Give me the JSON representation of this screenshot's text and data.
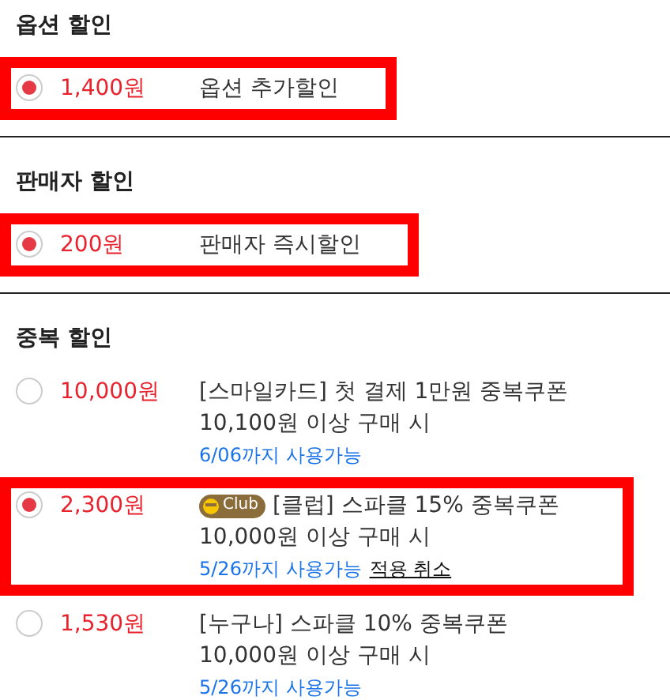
{
  "sections": [
    {
      "title": "옵션 할인",
      "options": [
        {
          "selected": true,
          "highlighted": true,
          "amount": "1,400원",
          "title": "옵션 추가할인"
        }
      ]
    },
    {
      "title": "판매자 할인",
      "options": [
        {
          "selected": true,
          "highlighted": true,
          "amount": "200원",
          "title": "판매자 즉시할인"
        }
      ]
    },
    {
      "title": "중복 할인",
      "options": [
        {
          "selected": false,
          "highlighted": false,
          "amount": "10,000원",
          "title": "[스마일카드] 첫 결제 1만원 중복쿠폰",
          "condition": "10,100원 이상 구매 시",
          "validity": "6/06까지 사용가능"
        },
        {
          "selected": true,
          "highlighted": true,
          "amount": "2,300원",
          "badge": "Club",
          "title": "[클럽] 스파클 15% 중복쿠폰",
          "condition": "10,000원 이상 구매 시",
          "validity": "5/26까지 사용가능",
          "cancel_link": "적용 취소"
        },
        {
          "selected": false,
          "highlighted": false,
          "amount": "1,530원",
          "title": "[누구나] 스파클 10% 중복쿠폰",
          "condition": "10,000원 이상 구매 시",
          "validity": "5/26까지 사용가능"
        }
      ]
    }
  ]
}
